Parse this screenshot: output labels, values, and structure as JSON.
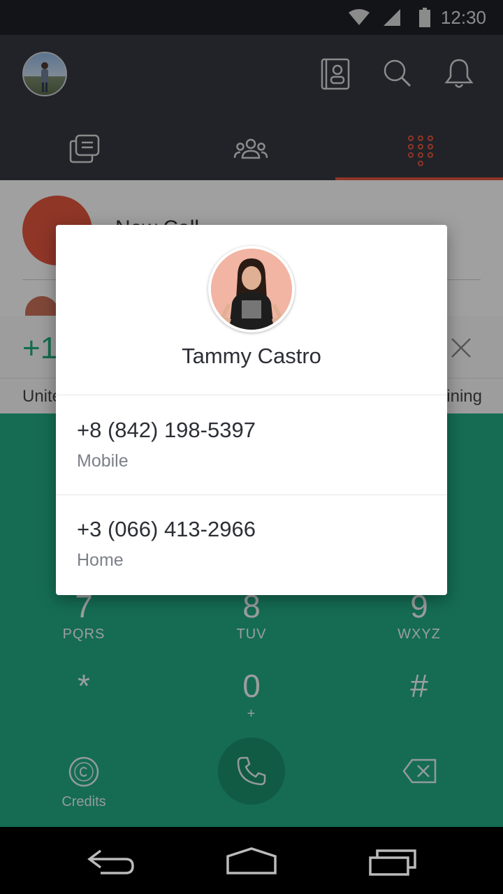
{
  "status_bar": {
    "time": "12:30",
    "icons": [
      "wifi-icon",
      "signal-icon",
      "battery-icon"
    ]
  },
  "app_bar": {
    "avatar": "user-avatar",
    "actions": [
      "contacts-book-icon",
      "search-icon",
      "bell-icon"
    ]
  },
  "tabs": [
    {
      "name": "chats",
      "icon": "chat-icon",
      "selected": false
    },
    {
      "name": "contacts",
      "icon": "people-icon",
      "selected": false
    },
    {
      "name": "dialpad",
      "icon": "dialpad-icon",
      "selected": true
    }
  ],
  "accent_color": "#e0553d",
  "dialpad_color": "#22a982",
  "background_list": {
    "new_call_label": "New Call"
  },
  "number_entry": {
    "value": "+1",
    "country": "Unite",
    "remaining": "ining"
  },
  "dialpad": {
    "keys": [
      {
        "digit": "7",
        "letters": "PQRS"
      },
      {
        "digit": "8",
        "letters": "TUV"
      },
      {
        "digit": "9",
        "letters": "WXYZ"
      },
      {
        "digit": "*",
        "letters": ""
      },
      {
        "digit": "0",
        "letters": "+"
      },
      {
        "digit": "#",
        "letters": ""
      }
    ],
    "credits_label": "Credits"
  },
  "dialog": {
    "contact_name": "Tammy Castro",
    "numbers": [
      {
        "number": "+8 (842) 198-5397",
        "type": "Mobile"
      },
      {
        "number": "+3 (066) 413-2966",
        "type": "Home"
      }
    ]
  }
}
